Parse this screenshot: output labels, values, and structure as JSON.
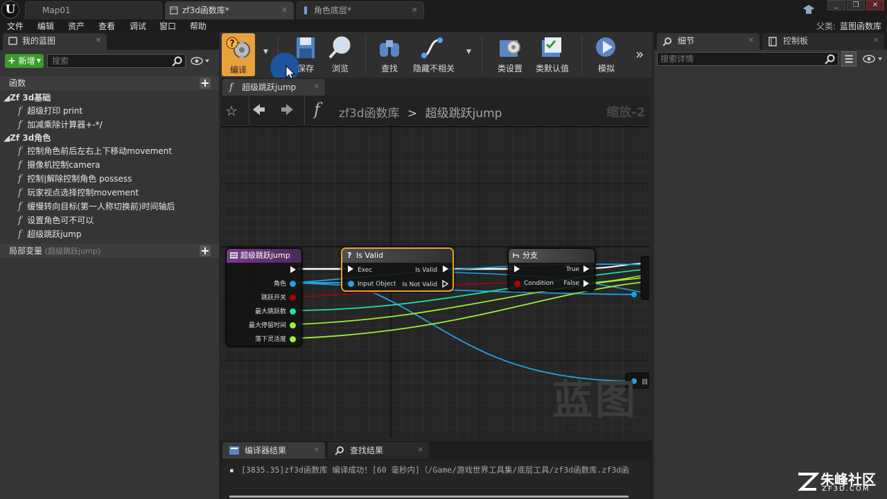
{
  "titlebar": {
    "logo": "U",
    "tabs": [
      {
        "label": "Map01"
      },
      {
        "label": "zf3d函数库*"
      },
      {
        "label": "角色底层*"
      }
    ],
    "window_buttons": [
      "_",
      "❐",
      "✕"
    ]
  },
  "menubar": {
    "items": [
      "文件",
      "编辑",
      "资产",
      "查看",
      "调试",
      "窗口",
      "帮助"
    ],
    "parent_label": "父类:",
    "parent_value": "蓝图函数库"
  },
  "left_panel": {
    "tab": "我的蓝图",
    "new_button": "新增",
    "search_placeholder": "搜索",
    "functions_header": "函数",
    "categories": [
      {
        "name": "Zf 3d基础",
        "items": [
          "超级打印 print",
          "加减乘除计算器+-*/"
        ]
      },
      {
        "name": "Zf 3d角色",
        "items": [
          "控制角色前后左右上下移动movement",
          "摄像机控制camera",
          "控制|解除控制角色 possess",
          "玩家视点选择控制movement",
          "缓慢转向目标(第一人称切换前)时间轴后",
          "设置角色可不可以",
          "超级跳跃jump"
        ]
      }
    ],
    "local_vars_header": "局部变量",
    "local_vars_hint": "(超级跳跃jump)"
  },
  "toolbar": {
    "compile": "编译",
    "save": "保存",
    "browse": "浏览",
    "find": "查找",
    "hide_unrelated": "隐藏不相关",
    "class_settings": "类设置",
    "class_defaults": "类默认值",
    "simulate": "模拟"
  },
  "graph": {
    "tab": "超级跳跃jump",
    "breadcrumb_root": "zf3d函数库",
    "breadcrumb_sep": ">",
    "breadcrumb_leaf": "超级跳跃jump",
    "zoom": "缩放-2",
    "watermark": "蓝图",
    "nodes": {
      "entry": {
        "title": "超级跳跃jump",
        "pins": [
          "角色",
          "跳跃开关",
          "最大跳跃数",
          "最大停留时间",
          "落下灵活度"
        ]
      },
      "isvalid": {
        "title": "Is Valid",
        "icon": "?",
        "in_exec": "Exec",
        "in_obj": "Input Object",
        "out_valid": "Is Valid",
        "out_not": "Is Not Valid"
      },
      "branch": {
        "title": "分支",
        "condition": "Condition",
        "true": "True",
        "false": "False"
      },
      "partial_label": "目"
    }
  },
  "right_panel": {
    "tab_details": "细节",
    "tab_palette": "控制板",
    "search_placeholder": "搜索详情"
  },
  "bottom_panel": {
    "tab_compiler": "编译器结果",
    "tab_find": "查找结果",
    "log_line": "[3835.35]zf3d函数库 编译成功！[60 毫秒内]（/Game/游戏世界工具集/底层工具/zf3d函数库.zf3d函"
  },
  "watermark": {
    "big": "朱峰社区",
    "small": "ZF3D.COM"
  },
  "colors": {
    "compile_accent": "#e8a13b",
    "new_button": "#3b9a2a",
    "entry_header": "#6a2f7a",
    "isvalid_border": "#f0a020",
    "object_pin": "#1ea3e6",
    "bool_pin": "#b00000",
    "int_pin": "#1fe0a0",
    "float_pin": "#9bf03a"
  }
}
